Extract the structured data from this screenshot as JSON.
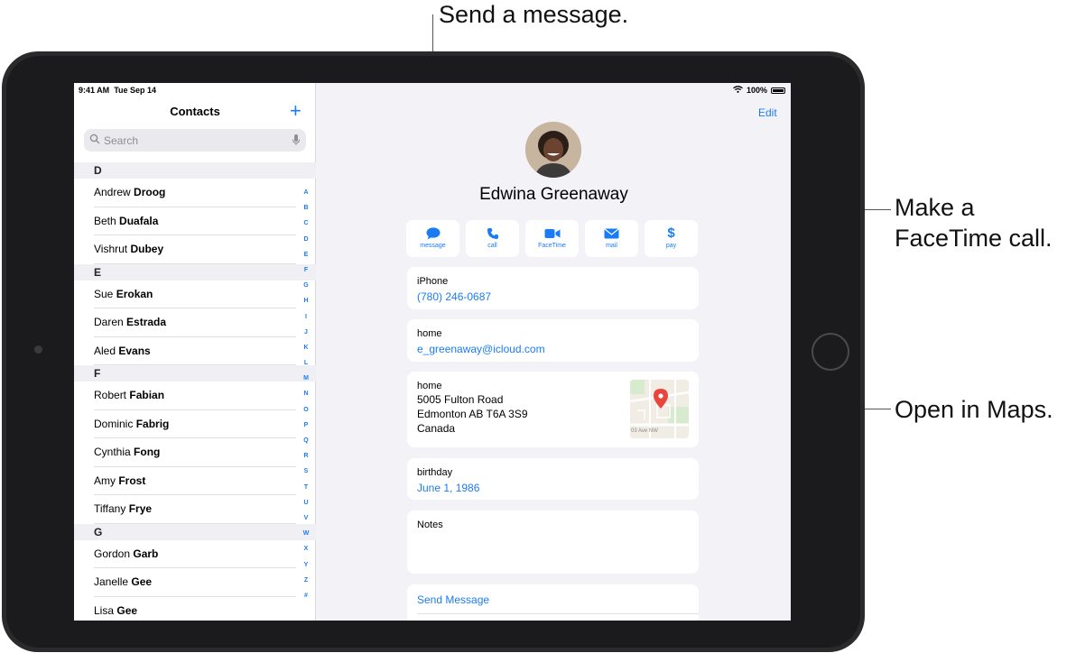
{
  "callouts": {
    "message": "Send a message.",
    "facetime_line1": "Make a",
    "facetime_line2": "FaceTime call.",
    "maps": "Open in Maps."
  },
  "status_bar": {
    "time": "9:41 AM",
    "date": "Tue Sep 14",
    "battery": "100%"
  },
  "sidebar": {
    "title": "Contacts",
    "add_label": "+",
    "search_placeholder": "Search",
    "sections": [
      {
        "header": "D",
        "contacts": [
          {
            "first": "Andrew",
            "last": "Droog"
          },
          {
            "first": "Beth",
            "last": "Duafala"
          },
          {
            "first": "Vishrut",
            "last": "Dubey"
          }
        ]
      },
      {
        "header": "E",
        "contacts": [
          {
            "first": "Sue",
            "last": "Erokan"
          },
          {
            "first": "Daren",
            "last": "Estrada"
          },
          {
            "first": "Aled",
            "last": "Evans"
          }
        ]
      },
      {
        "header": "F",
        "contacts": [
          {
            "first": "Robert",
            "last": "Fabian"
          },
          {
            "first": "Dominic",
            "last": "Fabrig"
          },
          {
            "first": "Cynthia",
            "last": "Fong"
          },
          {
            "first": "Amy",
            "last": "Frost"
          },
          {
            "first": "Tiffany",
            "last": "Frye"
          }
        ]
      },
      {
        "header": "G",
        "contacts": [
          {
            "first": "Gordon",
            "last": "Garb"
          },
          {
            "first": "Janelle",
            "last": "Gee"
          },
          {
            "first": "Lisa",
            "last": "Gee"
          }
        ]
      }
    ],
    "index": [
      "A",
      "B",
      "C",
      "D",
      "E",
      "F",
      "G",
      "H",
      "I",
      "J",
      "K",
      "L",
      "M",
      "N",
      "O",
      "P",
      "Q",
      "R",
      "S",
      "T",
      "U",
      "V",
      "W",
      "X",
      "Y",
      "Z",
      "#"
    ]
  },
  "detail": {
    "edit_label": "Edit",
    "name": "Edwina Greenaway",
    "actions": [
      {
        "label": "message",
        "icon": "message-bubble-icon"
      },
      {
        "label": "call",
        "icon": "phone-icon"
      },
      {
        "label": "FaceTime",
        "icon": "video-camera-icon"
      },
      {
        "label": "mail",
        "icon": "envelope-icon"
      },
      {
        "label": "pay",
        "icon": "dollar-icon"
      }
    ],
    "phone": {
      "label": "iPhone",
      "value": "(780) 246-0687"
    },
    "email": {
      "label": "home",
      "value": "e_greenaway@icloud.com"
    },
    "address": {
      "label": "home",
      "line1": "5005 Fulton Road",
      "line2": "Edmonton AB T6A 3S9",
      "line3": "Canada",
      "map_street": "03 Ave NW"
    },
    "birthday": {
      "label": "birthday",
      "value": "June 1, 1986"
    },
    "notes": {
      "label": "Notes"
    },
    "send_message": "Send Message"
  }
}
